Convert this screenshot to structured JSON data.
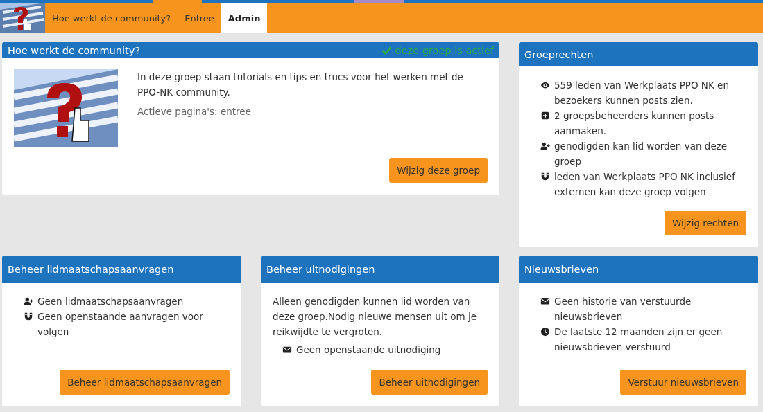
{
  "nav": {
    "tabs": [
      {
        "label": "Hoe werkt de community?",
        "selected": false
      },
      {
        "label": "Entree",
        "selected": false
      },
      {
        "label": "Admin",
        "selected": true
      }
    ]
  },
  "group": {
    "title": "Hoe werkt de community?",
    "active": true,
    "status": "deze groep is actief",
    "description": "In deze groep staan tutorials en tips en trucs voor het werken met de PPO-NK community.",
    "pages": "Actieve pagina's: entree",
    "button": "Wijzig deze groep"
  },
  "rights": {
    "title": "Groeprechten",
    "items": [
      {
        "kind": "view",
        "text": "559 leden van Werkplaats PPO NK en bezoekers kunnen posts zien."
      },
      {
        "kind": "post",
        "text": "2 groepsbeheerders kunnen posts aanmaken."
      },
      {
        "kind": "join",
        "text": "genodigden kan lid worden van deze groep"
      },
      {
        "kind": "follow",
        "text": "leden van Werkplaats PPO NK inclusief externen kan deze groep volgen"
      }
    ],
    "button": "Wijzig rechten"
  },
  "requests": {
    "title": "Beheer lidmaatschapsaanvragen",
    "items": [
      {
        "kind": "join",
        "text": "Geen lidmaatschapsaanvragen"
      },
      {
        "kind": "follow",
        "text": "Geen openstaande aanvragen voor volgen"
      }
    ],
    "button": "Beheer lidmaatschapsaanvragen"
  },
  "invitations": {
    "title": "Beheer uitnodigingen",
    "text": "Alleen genodigden kunnen lid worden van deze groep.Nodig nieuwe mensen uit om je reikwijdte te vergroten.",
    "items": [
      {
        "kind": "mail",
        "text": "Geen openstaande uitnodiging"
      }
    ],
    "button": "Beheer uitnodigingen"
  },
  "newsletters": {
    "title": "Nieuwsbrieven",
    "items": [
      {
        "kind": "mail",
        "text": "Geen historie van verstuurde nieuwsbrieven"
      },
      {
        "kind": "time",
        "text": "De laatste 12 maanden zijn er geen nieuwsbrieven verstuurd"
      }
    ],
    "button": "Verstuur nieuwsbrieven"
  }
}
